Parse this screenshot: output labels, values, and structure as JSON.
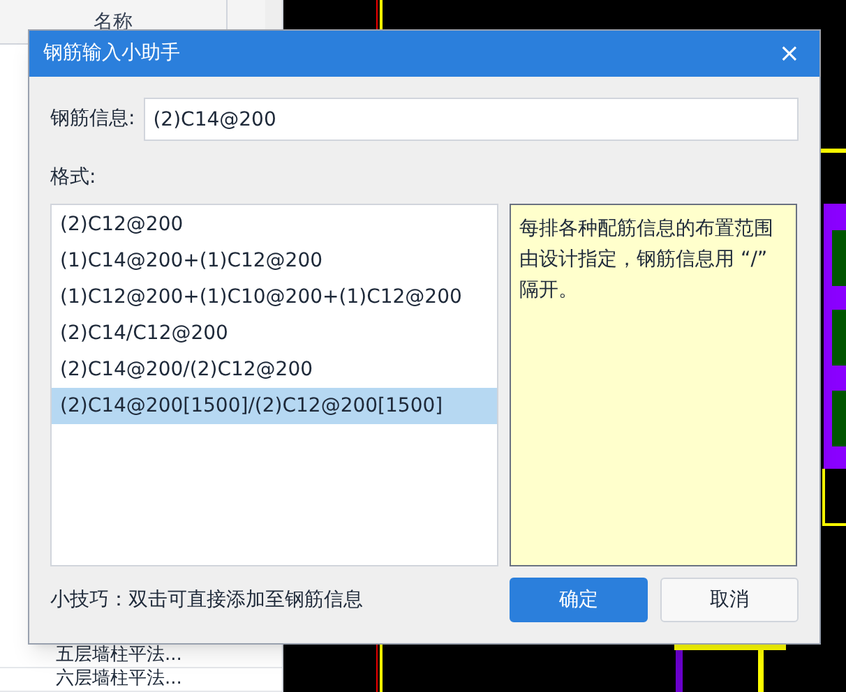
{
  "tree_panel": {
    "header": "名称",
    "items": [
      "五层墙柱平法...",
      "六层墙柱平法..."
    ]
  },
  "dialog": {
    "title": "钢筋输入小助手",
    "close": "×",
    "field": {
      "label": "钢筋信息:",
      "value": "(2)C14@200"
    },
    "format_label": "格式:",
    "formats": [
      {
        "text": "(2)C12@200",
        "selected": false
      },
      {
        "text": "(1)C14@200+(1)C12@200",
        "selected": false
      },
      {
        "text": "(1)C12@200+(1)C10@200+(1)C12@200",
        "selected": false
      },
      {
        "text": "(2)C14/C12@200",
        "selected": false
      },
      {
        "text": "(2)C14@200/(2)C12@200",
        "selected": false
      },
      {
        "text": "(2)C14@200[1500]/(2)C12@200[1500]",
        "selected": true
      }
    ],
    "description": "每排各种配筋信息的布置范围由设计指定，钢筋信息用 “/” 隔开。",
    "tip": "小技巧：双击可直接添加至钢筋信息",
    "buttons": [
      {
        "label": "确定",
        "kind": "primary"
      },
      {
        "label": "取消",
        "kind": "secondary"
      }
    ]
  }
}
